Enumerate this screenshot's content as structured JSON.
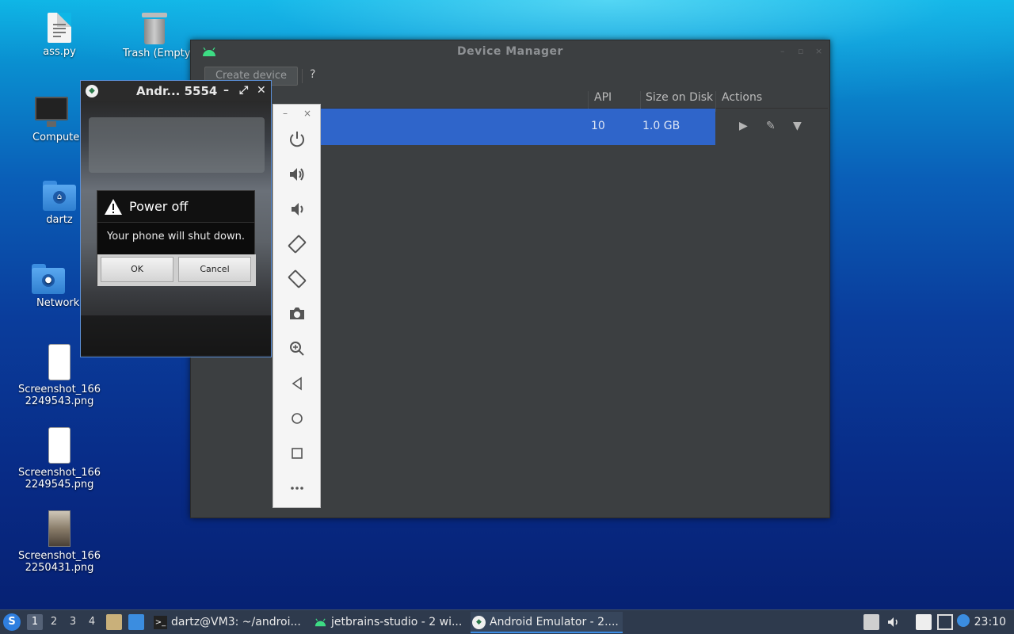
{
  "desktop": {
    "icons": [
      {
        "label": "ass.py",
        "icon": "python-file-icon"
      },
      {
        "label": "Trash (Empty)",
        "icon": "trash-icon"
      },
      {
        "label": "Computer",
        "icon": "computer-icon"
      },
      {
        "label": "dartz",
        "icon": "home-folder-icon"
      },
      {
        "label": "Network",
        "icon": "network-folder-icon"
      },
      {
        "label": "Screenshot_1662249543.png",
        "line1": "Screenshot_166",
        "line2": "2249543.png",
        "icon": "image-file-icon"
      },
      {
        "label": "Screenshot_1662249545.png",
        "line1": "Screenshot_166",
        "line2": "2249545.png",
        "icon": "image-file-icon"
      },
      {
        "label": "Screenshot_1662250431.png",
        "line1": "Screenshot_166",
        "line2": "2250431.png",
        "icon": "image-file-icon"
      }
    ]
  },
  "device_manager": {
    "title": "Device Manager",
    "create_button": "Create device",
    "help_button": "?",
    "columns": [
      "API",
      "Size on Disk",
      "Actions"
    ],
    "rows": [
      {
        "api": "10",
        "size": "1.0 GB"
      }
    ]
  },
  "emulator": {
    "title": "Andr... 5554",
    "dialog": {
      "title": "Power off",
      "message": "Your phone will shut down.",
      "ok": "OK",
      "cancel": "Cancel"
    }
  },
  "side_toolbar": {
    "minimize": "–",
    "close": "×",
    "tools": [
      "power-icon",
      "volume-up-icon",
      "volume-down-icon",
      "rotate-left-icon",
      "rotate-right-icon",
      "camera-icon",
      "zoom-icon",
      "back-icon",
      "home-icon",
      "overview-icon",
      "more-icon"
    ]
  },
  "taskbar": {
    "workspaces": [
      "1",
      "2",
      "3",
      "4"
    ],
    "active_workspace": "1",
    "windows": [
      {
        "label": "dartz@VM3: ~/androi...",
        "icon": "terminal-icon"
      },
      {
        "label": "jetbrains-studio - 2 wi...",
        "icon": "android-icon"
      },
      {
        "label": "Android Emulator - 2....",
        "icon": "emulator-icon"
      }
    ],
    "clock": "23:10"
  },
  "colors": {
    "selection": "#2f65ca",
    "dark_panel": "#3c3f41",
    "taskbar": "#2e3a4d"
  }
}
